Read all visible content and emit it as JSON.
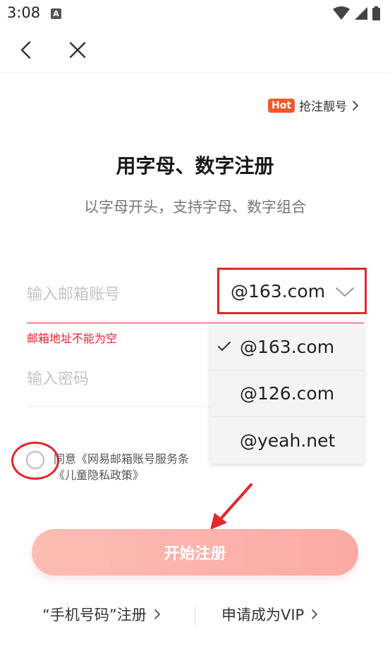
{
  "status_bar": {
    "time": "3:08",
    "app_indicator": "A"
  },
  "nav": {
    "back_icon": "chevron-left-icon",
    "close_icon": "close-icon"
  },
  "hot_link": {
    "badge": "Hot",
    "label": "抢注靓号"
  },
  "page": {
    "title": "用字母、数字注册",
    "subtitle": "以字母开头，支持字母、数字组合"
  },
  "email": {
    "placeholder": "输入邮箱账号",
    "domain_selected": "@163.com",
    "error": "邮箱地址不能为空"
  },
  "password": {
    "placeholder": "输入密码"
  },
  "domain_options": [
    {
      "label": "@163.com",
      "checked": true
    },
    {
      "label": "@126.com",
      "checked": false
    },
    {
      "label": "@yeah.net",
      "checked": false
    }
  ],
  "agreement": {
    "line1": "同意《网易邮箱账号服务条",
    "line2": "《儿童隐私政策》"
  },
  "register_button": {
    "label": "开始注册"
  },
  "bottom_links": {
    "phone_register": "“手机号码”注册",
    "vip": "申请成为VIP"
  },
  "colors": {
    "accent_red": "#e3272d",
    "hot_badge": "#f05a28",
    "button_gradient_start": "#fcbdb3",
    "button_gradient_end": "#fcaaa4"
  }
}
